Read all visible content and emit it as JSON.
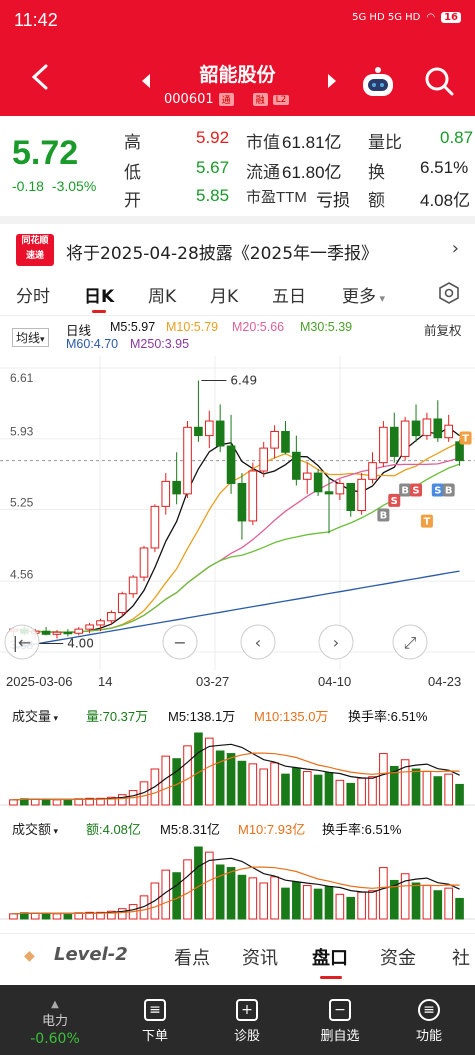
{
  "status": {
    "time": "11:42",
    "icons_text": "5G HD 5G HD",
    "battery": "16"
  },
  "nav": {
    "title": "韶能股份",
    "code": "000601",
    "tag1": "通",
    "tag2": "融",
    "tag3": "L2"
  },
  "quote": {
    "price": "5.72",
    "change": "-0.18",
    "change_pct": "-3.05%",
    "high_label": "高",
    "high": "5.92",
    "low_label": "低",
    "low": "5.67",
    "open_label": "开",
    "open": "5.85",
    "mktcap_label": "市值",
    "mktcap": "61.81亿",
    "float_label": "流通",
    "float": "61.80亿",
    "pe_label": "市盈TTM",
    "pe": "亏损",
    "vr_label": "量比",
    "vr": "0.87",
    "turnover_label": "换",
    "turnover": "6.51%",
    "amount_label": "额",
    "amount": "4.08亿"
  },
  "news": {
    "logo_line1": "同花顺",
    "logo_line2": "速递",
    "text": "将于2025-04-28披露《2025年一季报》"
  },
  "tabs": [
    "分时",
    "日K",
    "周K",
    "月K",
    "五日",
    "更多"
  ],
  "ma": {
    "selector": "均线",
    "period": "日线",
    "m5": "M5:5.97",
    "m10": "M10:5.79",
    "m20": "M20:5.66",
    "m30": "M30:5.39",
    "m60": "M60:4.70",
    "m250": "M250:3.95",
    "adjust": "前复权"
  },
  "colors": {
    "m5": "#111111",
    "m10": "#e8a020",
    "m20": "#e0609a",
    "m30": "#6cbf3a",
    "m60": "#2a5aa8",
    "m250": "#8a3aa0",
    "up": "#e02020",
    "down": "#1a7a1a"
  },
  "chart_data": {
    "type": "candlestick",
    "y_ticks": [
      "6.61",
      "5.93",
      "5.25",
      "4.56",
      "3.88"
    ],
    "ylim": [
      3.88,
      6.61
    ],
    "annotations": {
      "max": "6.49",
      "min": "4.00"
    },
    "x_labels": [
      "2025-03-06",
      "14",
      "03-27",
      "04-10",
      "04-23"
    ],
    "trade_markers": [
      "B",
      "S",
      "B",
      "S",
      "S",
      "B",
      "T",
      "T"
    ],
    "candles": [
      [
        4.08,
        4.12,
        4.02,
        4.1
      ],
      [
        4.1,
        4.14,
        4.04,
        4.06
      ],
      [
        4.06,
        4.1,
        4.0,
        4.08
      ],
      [
        4.08,
        4.12,
        4.04,
        4.05
      ],
      [
        4.05,
        4.09,
        4.01,
        4.07
      ],
      [
        4.07,
        4.1,
        4.03,
        4.06
      ],
      [
        4.06,
        4.12,
        4.04,
        4.1
      ],
      [
        4.1,
        4.16,
        4.06,
        4.14
      ],
      [
        4.14,
        4.2,
        4.08,
        4.18
      ],
      [
        4.18,
        4.28,
        4.14,
        4.26
      ],
      [
        4.26,
        4.46,
        4.22,
        4.44
      ],
      [
        4.44,
        4.62,
        4.4,
        4.6
      ],
      [
        4.6,
        4.9,
        4.56,
        4.88
      ],
      [
        4.88,
        5.3,
        4.84,
        5.28
      ],
      [
        5.28,
        5.6,
        5.2,
        5.52
      ],
      [
        5.52,
        5.8,
        5.3,
        5.4
      ],
      [
        5.4,
        6.1,
        5.36,
        6.04
      ],
      [
        6.04,
        6.49,
        5.9,
        5.96
      ],
      [
        5.96,
        6.2,
        5.84,
        6.1
      ],
      [
        6.1,
        6.26,
        5.8,
        5.86
      ],
      [
        5.86,
        6.16,
        5.4,
        5.5
      ],
      [
        5.5,
        5.6,
        4.96,
        5.14
      ],
      [
        5.14,
        5.7,
        5.1,
        5.62
      ],
      [
        5.62,
        5.9,
        5.56,
        5.84
      ],
      [
        5.84,
        6.06,
        5.74,
        6.0
      ],
      [
        6.0,
        6.1,
        5.78,
        5.8
      ],
      [
        5.8,
        5.96,
        5.48,
        5.54
      ],
      [
        5.54,
        5.7,
        5.4,
        5.6
      ],
      [
        5.6,
        5.64,
        5.38,
        5.42
      ],
      [
        5.42,
        5.56,
        5.02,
        5.4
      ],
      [
        5.4,
        5.54,
        5.34,
        5.5
      ],
      [
        5.5,
        5.5,
        5.18,
        5.24
      ],
      [
        5.24,
        5.6,
        5.2,
        5.54
      ],
      [
        5.54,
        5.8,
        5.5,
        5.7
      ],
      [
        5.7,
        6.1,
        5.66,
        6.04
      ],
      [
        6.04,
        6.18,
        5.7,
        5.76
      ],
      [
        5.76,
        6.14,
        5.72,
        6.1
      ],
      [
        6.1,
        6.26,
        5.9,
        5.96
      ],
      [
        5.96,
        6.18,
        5.92,
        6.12
      ],
      [
        6.12,
        6.3,
        5.9,
        5.94
      ],
      [
        5.94,
        6.16,
        5.9,
        6.06
      ],
      [
        5.9,
        5.92,
        5.67,
        5.72
      ]
    ]
  },
  "volume": {
    "title": "成交量",
    "vol": "量:70.37万",
    "m5": "M5:138.1万",
    "m10": "M10:135.0万",
    "turnover": "换手率:6.51%"
  },
  "amount": {
    "title": "成交额",
    "amt": "额:4.08亿",
    "m5": "M5:8.31亿",
    "m10": "M10:7.93亿",
    "turnover": "换手率:6.51%"
  },
  "volumes": [
    10,
    12,
    11,
    11,
    10,
    10,
    12,
    13,
    13,
    15,
    20,
    28,
    45,
    70,
    95,
    90,
    115,
    140,
    130,
    105,
    100,
    85,
    80,
    70,
    82,
    60,
    72,
    65,
    58,
    63,
    48,
    42,
    52,
    55,
    100,
    75,
    88,
    70,
    65,
    55,
    60,
    40
  ],
  "bottom_tabs": [
    "Level-2",
    "看点",
    "资讯",
    "盘口",
    "资金",
    "社"
  ],
  "toolbar": [
    {
      "label": "电力",
      "value": "-0.60%"
    },
    {
      "label": "下单"
    },
    {
      "label": "诊股"
    },
    {
      "label": "删自选"
    },
    {
      "label": "功能"
    }
  ]
}
